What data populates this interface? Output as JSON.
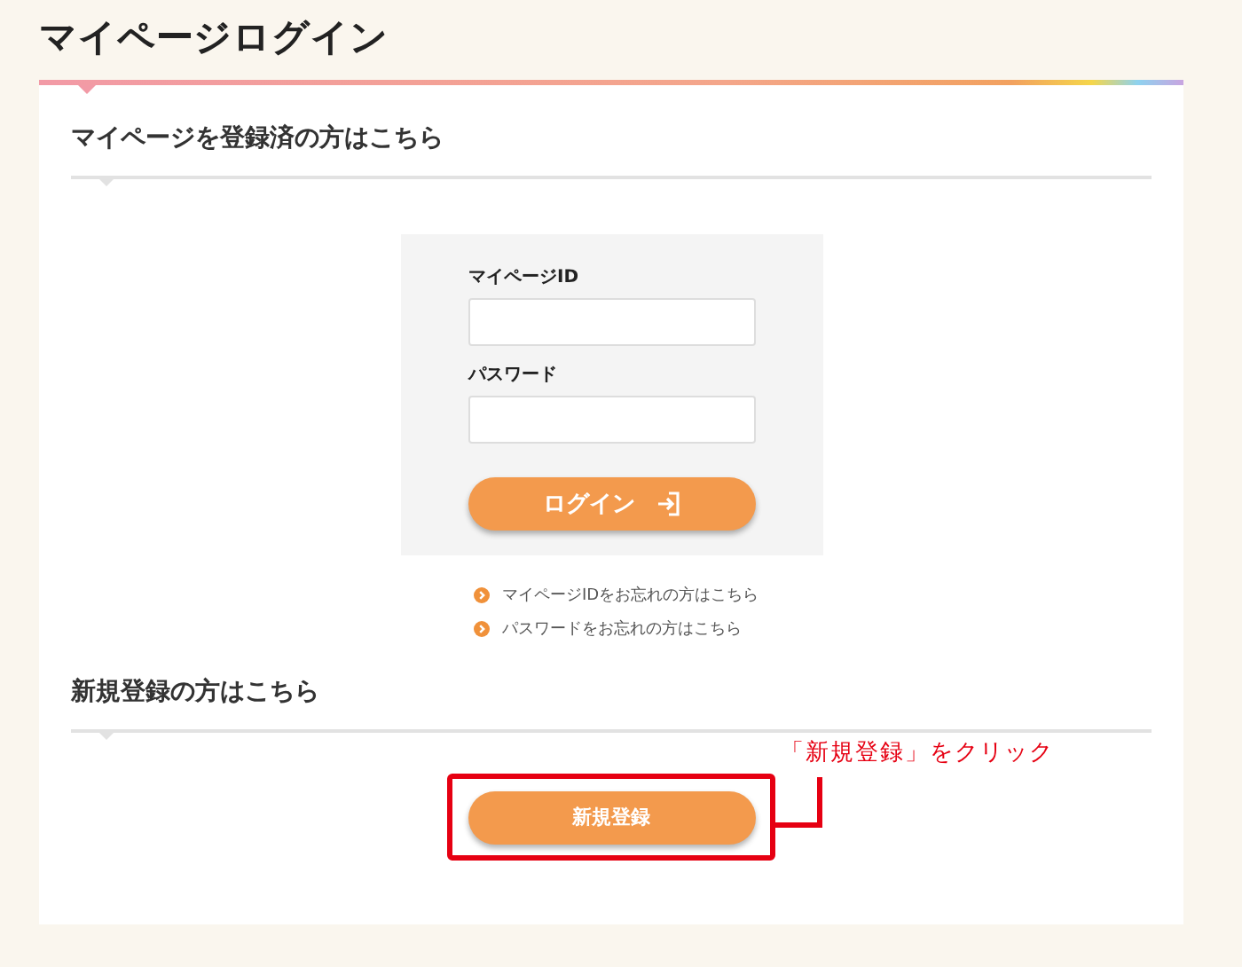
{
  "page_title": "マイページログイン",
  "login_section": {
    "heading": "マイページを登録済の方はこちら",
    "fields": [
      {
        "label": "マイページID"
      },
      {
        "label": "パスワード"
      }
    ],
    "login_button": "ログイン",
    "links": [
      "マイページIDをお忘れの方はこちら",
      "パスワードをお忘れの方はこちら"
    ]
  },
  "register_section": {
    "heading": "新規登録の方はこちら",
    "register_button": "新規登録"
  },
  "annotation": {
    "text": "「新規登録」をクリック"
  }
}
